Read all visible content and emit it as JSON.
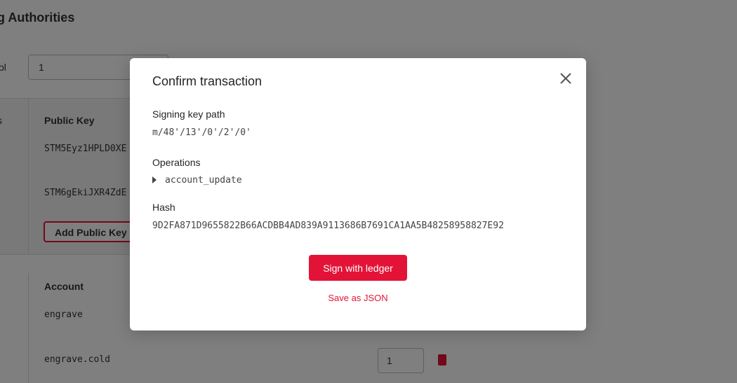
{
  "background": {
    "title": "g Authorities",
    "threshold_label": "ol",
    "threshold_value": "1",
    "keys_col_label": "s",
    "keys_header": "Public Key",
    "keys": [
      "STM5Eyz1HPLD0XE",
      "STM6gEkiJXR4ZdE"
    ],
    "add_key_label": "Add Public Key",
    "accounts_header": "Account",
    "accounts": [
      "engrave",
      "engrave.cold"
    ],
    "weight_value": "1",
    "colors": {
      "accent": "#e31337",
      "overlay": "rgba(0,0,0,0.5)"
    }
  },
  "modal": {
    "title": "Confirm transaction",
    "close_icon": "close-icon",
    "signing_key_label": "Signing key path",
    "signing_key_value": "m/48'/13'/0'/2'/0'",
    "operations_label": "Operations",
    "operation_item": "account_update",
    "hash_label": "Hash",
    "hash_value": "9D2FA871D9655822B66ACDBB4AD839A9113686B7691CA1AA5B48258958827E92",
    "sign_button": "Sign with ledger",
    "save_link": "Save as JSON"
  }
}
